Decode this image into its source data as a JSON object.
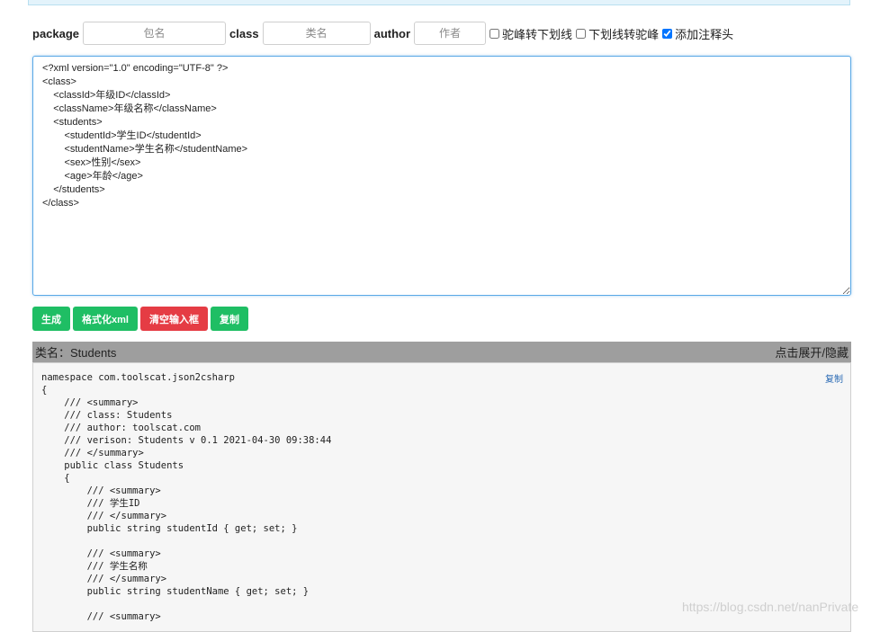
{
  "form": {
    "package_label": "package",
    "package_placeholder": "包名",
    "class_label": "class",
    "class_placeholder": "类名",
    "author_label": "author",
    "author_placeholder": "作者",
    "checkbox_camel_to_underscore": "驼峰转下划线",
    "checkbox_underscore_to_camel": "下划线转驼峰",
    "checkbox_add_comment_header": "添加注释头"
  },
  "editor": {
    "value": "<?xml version=\"1.0\" encoding=\"UTF-8\" ?>\n<class>\n    <classId>年级ID</classId>\n    <className>年级名称</className>\n    <students>\n        <studentId>学生ID</studentId>\n        <studentName>学生名称</studentName>\n        <sex>性别</sex>\n        <age>年龄</age>\n    </students>\n</class>\n"
  },
  "buttons": {
    "generate": "生成",
    "format_xml": "格式化xml",
    "clear_input": "清空输入框",
    "copy": "复制"
  },
  "result": {
    "class_name_label": "类名：Students",
    "toggle_label": "点击展开/隐藏",
    "copy_link": "复制",
    "code": "namespace com.toolscat.json2csharp\n{\n    /// <summary>\n    /// class: Students\n    /// author: toolscat.com\n    /// verison: Students v 0.1 2021-04-30 09:38:44\n    /// </summary>\n    public class Students\n    {\n        /// <summary>\n        /// 学生ID\n        /// </summary>\n        public string studentId { get; set; }\n\n        /// <summary>\n        /// 学生名称\n        /// </summary>\n        public string studentName { get; set; }\n\n        /// <summary>"
  },
  "watermark": "https://blog.csdn.net/nanPrivate",
  "colors": {
    "button_green": "#1fbe64",
    "button_red": "#e53c44",
    "result_bar": "#9e9e9e",
    "editor_border": "#5aa8e6",
    "link_blue": "#2a6ab4"
  }
}
